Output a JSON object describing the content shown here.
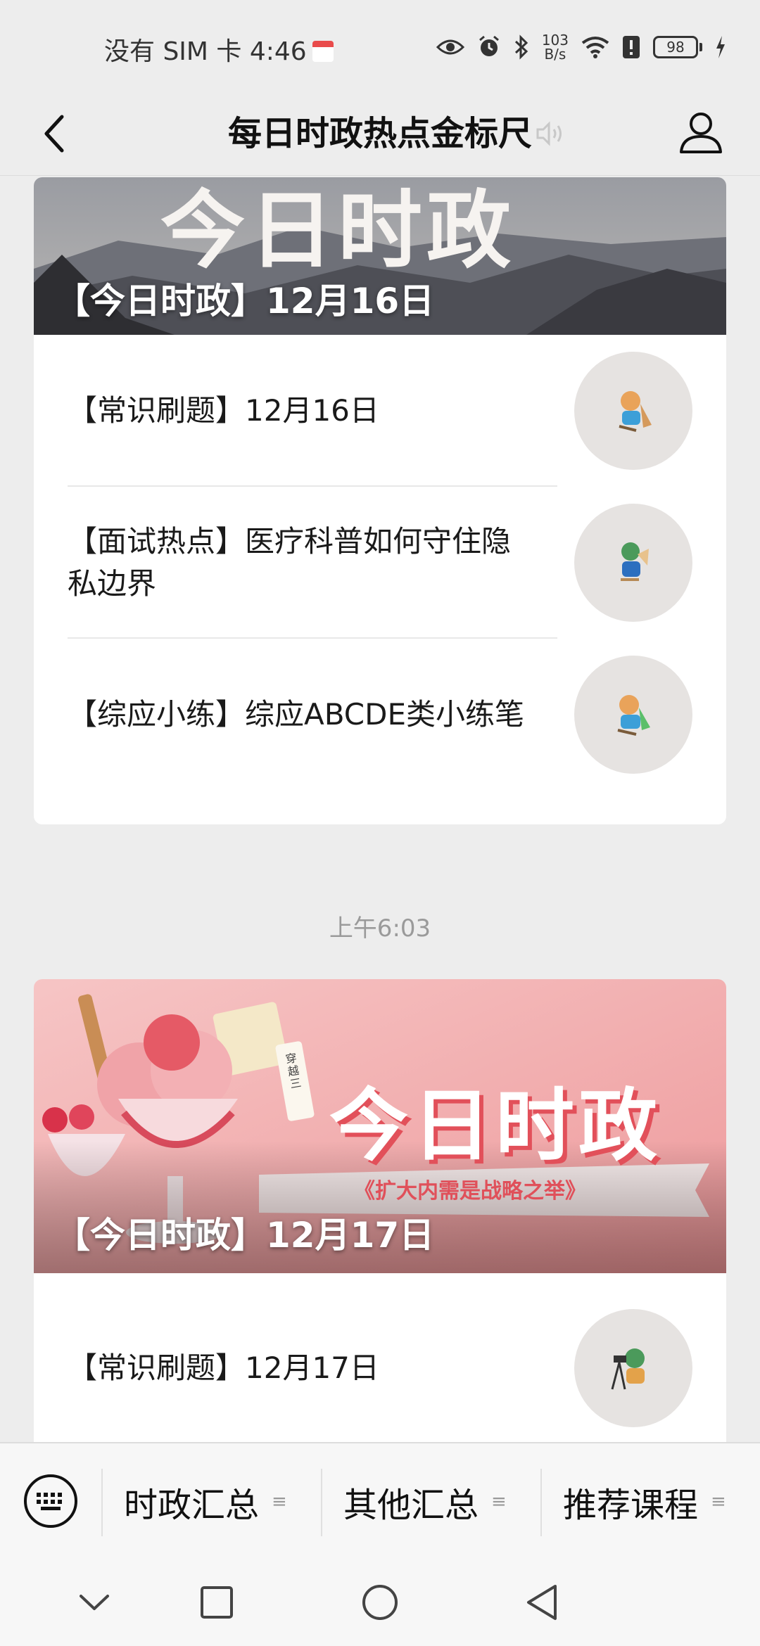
{
  "status_bar": {
    "carrier_time": "没有 SIM 卡 4:46",
    "net_speed_value": "103",
    "net_speed_unit": "B/s",
    "battery": "98"
  },
  "nav": {
    "title": "每日时政热点金标尺"
  },
  "feed": {
    "card1": {
      "banner_text": "今日时政",
      "banner_title": "【今日时政】12月16日",
      "items": [
        {
          "title": "【常识刷题】12月16日"
        },
        {
          "title": "【面试热点】医疗科普如何守住隐私边界"
        },
        {
          "title": "【综应小练】综应ABCDE类小练笔"
        }
      ]
    },
    "timestamp": "上午6:03",
    "card2": {
      "banner_text": "今日时政",
      "banner_subtitle": "《扩大内需是战略之举》",
      "banner_tag": "穿越三",
      "banner_title": "【今日时政】12月17日",
      "items": [
        {
          "title": "【常识刷题】12月17日"
        }
      ]
    }
  },
  "bottom_menu": {
    "items": [
      {
        "label": "时政汇总"
      },
      {
        "label": "其他汇总"
      },
      {
        "label": "推荐课程"
      }
    ],
    "menu_glyph": "≡"
  },
  "colors": {
    "background": "#ededed",
    "card": "#ffffff",
    "banner1_sky": "#8a8c92",
    "banner2_pink": "#f3b4b6",
    "accent_red": "#e9505a"
  }
}
